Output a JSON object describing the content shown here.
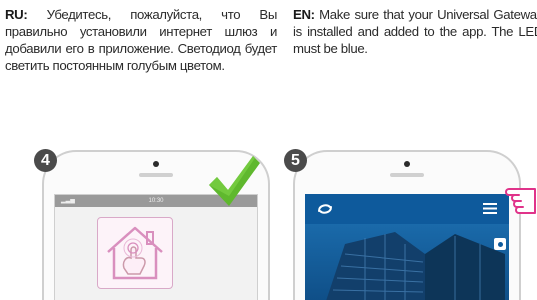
{
  "instructions": {
    "ru": {
      "lang": "RU:",
      "text": "Убедитесь, пожалуйста, что Вы правильно установили интернет шлюз и добавили его в приложение. Светодиод будет светить постоянным голубым цветом."
    },
    "en": {
      "lang": "EN:",
      "text": "Make sure that your Universal Gateway is installed and added to the app. The LED must be blue."
    }
  },
  "steps": [
    {
      "number": "4",
      "screen_time": "10:30",
      "icon": "house-hand-icon"
    },
    {
      "number": "5",
      "icon": "menu-icon"
    }
  ],
  "colors": {
    "badge": "#4b4b4b",
    "check": "#5fb82e",
    "app_header": "#0e5a9c",
    "hand_outline": "#e0338a"
  }
}
